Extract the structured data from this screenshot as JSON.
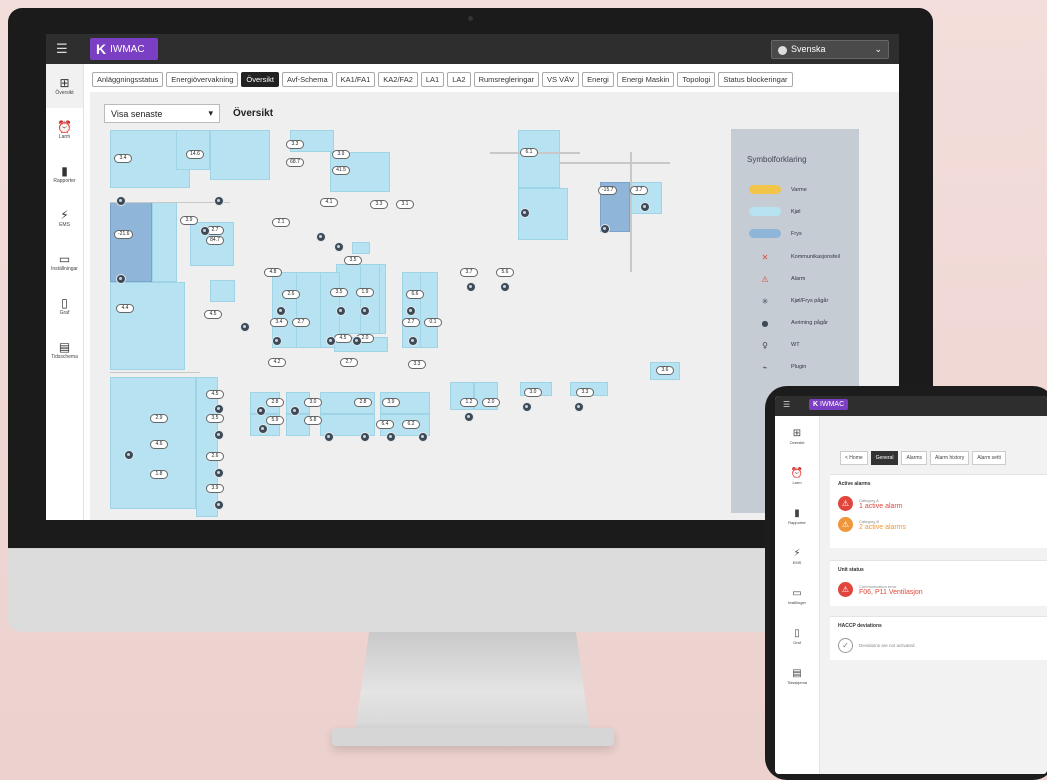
{
  "app": {
    "logo_letter": "K",
    "logo_text": "IWMAC",
    "language": "Svenska"
  },
  "sidebar": [
    {
      "icon": "overview-icon",
      "glyph": "⊞",
      "label": "Översikt"
    },
    {
      "icon": "alarm-icon",
      "glyph": "⏰",
      "label": "Larm"
    },
    {
      "icon": "reports-icon",
      "glyph": "▮",
      "label": "Rapporter"
    },
    {
      "icon": "energy-icon",
      "glyph": "⚡",
      "label": "EMS"
    },
    {
      "icon": "settings-icon",
      "glyph": "▭",
      "label": "Inställningar"
    },
    {
      "icon": "graph-icon",
      "glyph": "▯",
      "label": "Graf"
    },
    {
      "icon": "calendar-icon",
      "glyph": "▤",
      "label": "Tidsschema"
    }
  ],
  "tabs": [
    "Anläggningsstatus",
    "Energiövervakning",
    "Översikt",
    "Avf-Schema",
    "KA1/FA1",
    "KA2/FA2",
    "LA1",
    "LA2",
    "Rumsregleringar",
    "VS VÄV",
    "Energi",
    "Energi Maskin",
    "Topologi",
    "Status blockeringar"
  ],
  "active_tab": "Översikt",
  "view_select": "Visa senaste",
  "page_title": "Översikt",
  "legend": {
    "title": "Symbolforklaring",
    "items": [
      {
        "label": "Varme",
        "color": "#f2c54a",
        "kind": "swatch"
      },
      {
        "label": "Kjøl",
        "color": "#b7e2f1",
        "kind": "swatch"
      },
      {
        "label": "Frys",
        "color": "#8fb5d9",
        "kind": "swatch"
      },
      {
        "label": "Kommunikasjonsfeil",
        "icon": "comm-error-icon",
        "glyph": "✕",
        "color": "#e0463c",
        "kind": "icon"
      },
      {
        "label": "Alarm",
        "icon": "alarm-triangle-icon",
        "glyph": "⚠",
        "color": "#e0463c",
        "kind": "icon"
      },
      {
        "label": "Kjøl/Frys pågår",
        "icon": "cooling-active-icon",
        "glyph": "✳",
        "color": "#3e4a55",
        "kind": "icon"
      },
      {
        "label": "Avriming pågår",
        "icon": "defrost-icon",
        "glyph": "●",
        "color": "#3e4a55",
        "kind": "icon"
      },
      {
        "label": "WT",
        "icon": "wt-icon",
        "glyph": "♀",
        "color": "#444",
        "kind": "icon"
      },
      {
        "label": "Plugin",
        "icon": "plugin-icon",
        "glyph": "⌁",
        "color": "#444",
        "kind": "icon"
      }
    ]
  },
  "map": {
    "values": [
      "3.4",
      "14.6",
      "3.3",
      "68.7",
      "3.9",
      "41.5",
      "6.1",
      "-15.7",
      "3.7",
      "-21.6",
      "3.9",
      "2.7",
      "84.7",
      "4.1",
      "3.3",
      "3.1",
      "2.1",
      "3.5",
      "4.8",
      "4.4",
      "4.5",
      "3.5",
      "1.9",
      "2.6",
      "6.6",
      "3.4",
      "2.7",
      "2.7",
      "0.1",
      "4.5",
      "2.0",
      "4.2",
      "2.7",
      "3.3",
      "3.7",
      "5.6",
      "3.6",
      "2.9",
      "4.5",
      "3.5",
      "4.6",
      "2.6",
      "1.8",
      "3.9",
      "2.8",
      "3.0",
      "2.8",
      "3.9",
      "5.9",
      "5.8",
      "6.4",
      "6.2",
      "1.2",
      "2.0",
      "3.0",
      "3.3"
    ]
  },
  "tablet": {
    "logo_letter": "K",
    "logo_text": "IWMAC",
    "sidebar": [
      "Oversikt",
      "Larm",
      "Rapporter",
      "EMS",
      "Instillinger",
      "Graf",
      "Tidsskjema"
    ],
    "tabs": [
      "< Home",
      "General",
      "Alarms",
      "Alarm history",
      "Alarm setti"
    ],
    "active_tab": "General",
    "active_alarms_title": "Active alarms",
    "alarm1": {
      "cat": "Category A",
      "text": "1 active alarm",
      "color": "#e0463c"
    },
    "alarm2": {
      "cat": "Category B",
      "text": "2 active alarms",
      "color": "#f0963a"
    },
    "unit_status_title": "Unit status",
    "unit": {
      "cat": "Communication error",
      "text": "F06, P11 Ventilasjon",
      "color": "#e0463c"
    },
    "haccp_title": "HACCP deviations",
    "haccp_text": "Deviations are not activated"
  }
}
